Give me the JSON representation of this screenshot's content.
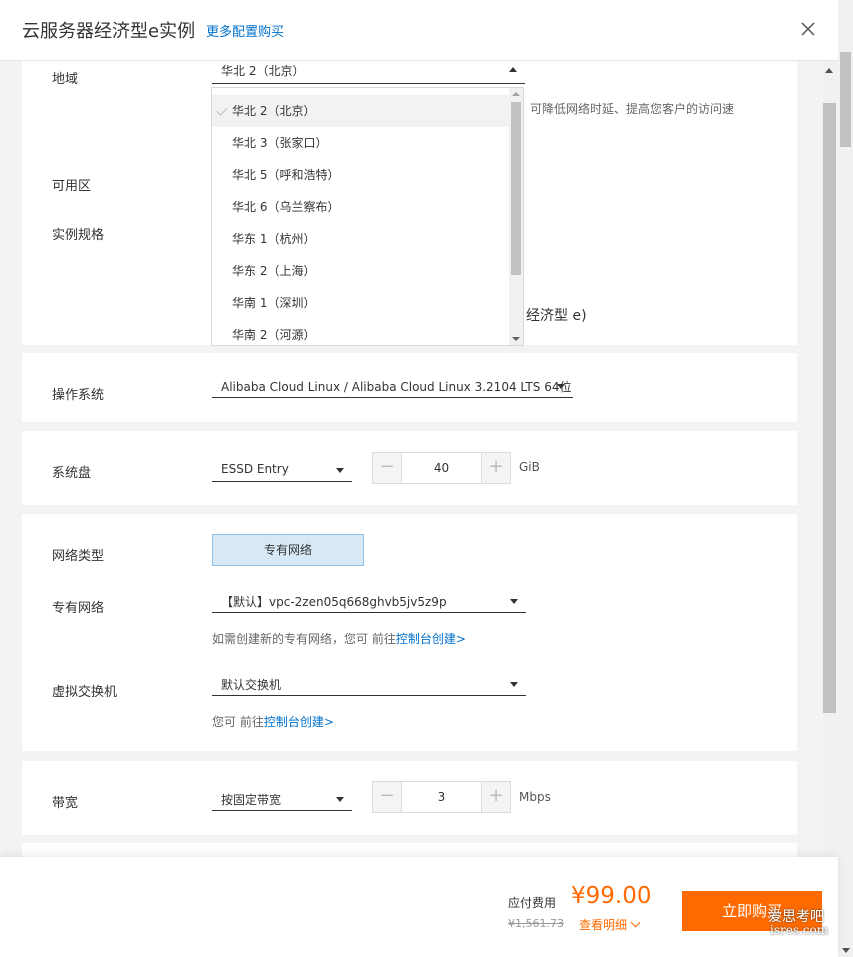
{
  "header": {
    "title": "云服务器经济型e实例",
    "more_link": "更多配置购买"
  },
  "region": {
    "label": "地域",
    "selected": "华北 2（北京）",
    "hint_partial": "，可降低网络时延、提高您客户的访问速",
    "options": [
      "华北 2（北京）",
      "华北 3（张家口）",
      "华北 5（呼和浩特）",
      "华北 6（乌兰察布）",
      "华东 1（杭州）",
      "华东 2（上海）",
      "华南 1（深圳）",
      "华南 2（河源）"
    ]
  },
  "zone": {
    "label": "可用区"
  },
  "instance": {
    "label": "实例规格",
    "partial_text": "经济型 e)"
  },
  "os": {
    "label": "操作系统",
    "value": "Alibaba Cloud Linux / Alibaba Cloud Linux 3.2104 LTS 64位"
  },
  "disk": {
    "label": "系统盘",
    "type": "ESSD Entry",
    "size": "40",
    "unit": "GiB"
  },
  "network": {
    "type_label": "网络类型",
    "type_value": "专有网络",
    "vpc_label": "专有网络",
    "vpc_value": "【默认】vpc-2zen05q668ghvb5jv5z9p",
    "vpc_hint_prefix": "如需创建新的专有网络，您可 前往",
    "vpc_hint_link": "控制台创建>",
    "vswitch_label": "虚拟交换机",
    "vswitch_value": "默认交换机",
    "vswitch_hint_prefix": "您可 前往",
    "vswitch_hint_link": "控制台创建>"
  },
  "bandwidth": {
    "label": "带宽",
    "mode": "按固定带宽",
    "value": "3",
    "unit": "Mbps"
  },
  "footer": {
    "fee_label": "应付费用",
    "price": "¥99.00",
    "original_price": "¥1,561.73",
    "detail_link": "查看明细",
    "buy_button": "立即购买"
  },
  "watermark": {
    "line1": "爱思考吧",
    "line2": "isres.com"
  },
  "colors": {
    "accent": "#ff6a00",
    "link": "#0070cc"
  }
}
